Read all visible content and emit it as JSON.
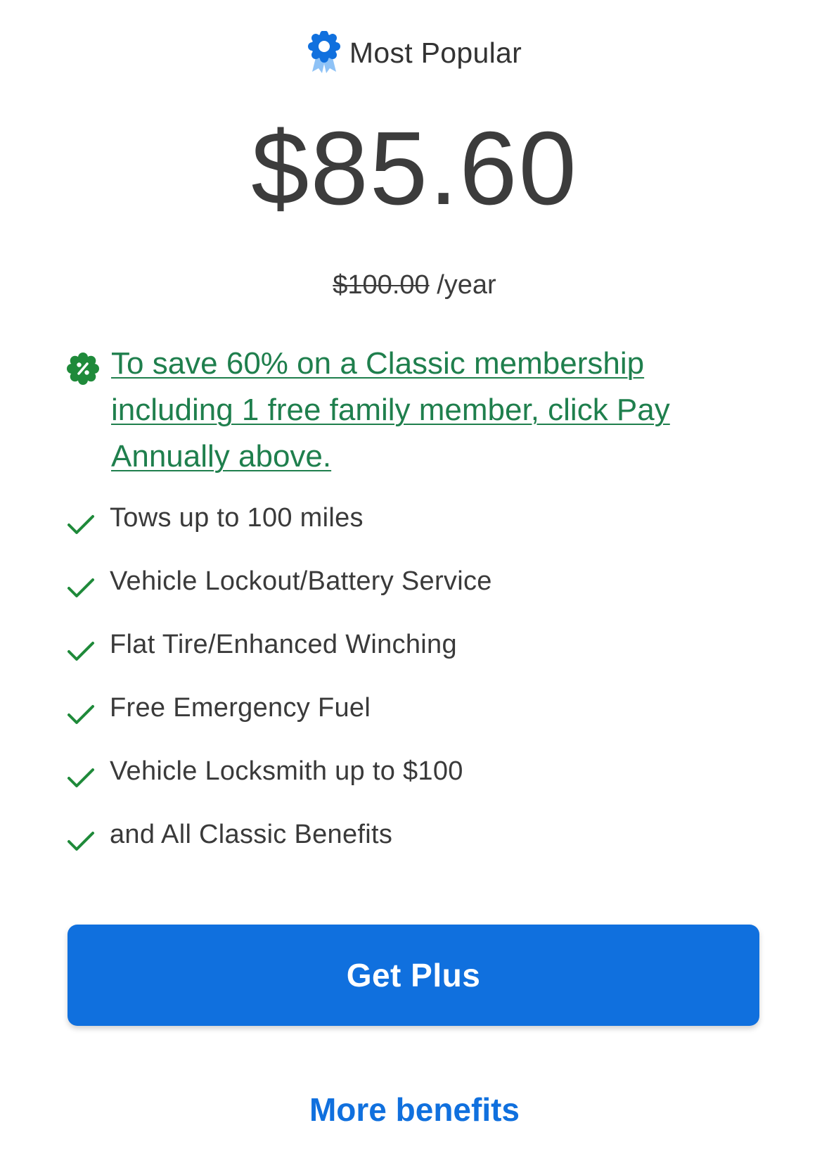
{
  "badge": {
    "icon": "award-ribbon-icon",
    "label": "Most Popular",
    "color": "#1070de"
  },
  "price": {
    "current": "$85.60",
    "original": "$100.00",
    "period": " /year"
  },
  "promo": {
    "icon": "discount-badge-icon",
    "text": "To save 60% on a Classic membership including 1 free family member, click Pay Annually above.",
    "color": "#1f7f4d"
  },
  "features": [
    {
      "icon": "check-icon",
      "label": "Tows up to 100 miles"
    },
    {
      "icon": "check-icon",
      "label": "Vehicle Lockout/Battery Service"
    },
    {
      "icon": "check-icon",
      "label": "Flat Tire/Enhanced Winching"
    },
    {
      "icon": "check-icon",
      "label": "Free Emergency Fuel"
    },
    {
      "icon": "check-icon",
      "label": "Vehicle Locksmith up to $100"
    },
    {
      "icon": "check-icon",
      "label": "and All Classic Benefits"
    }
  ],
  "cta": {
    "label": "Get Plus",
    "color": "#1070de"
  },
  "more_link": {
    "label": "More benefits"
  }
}
